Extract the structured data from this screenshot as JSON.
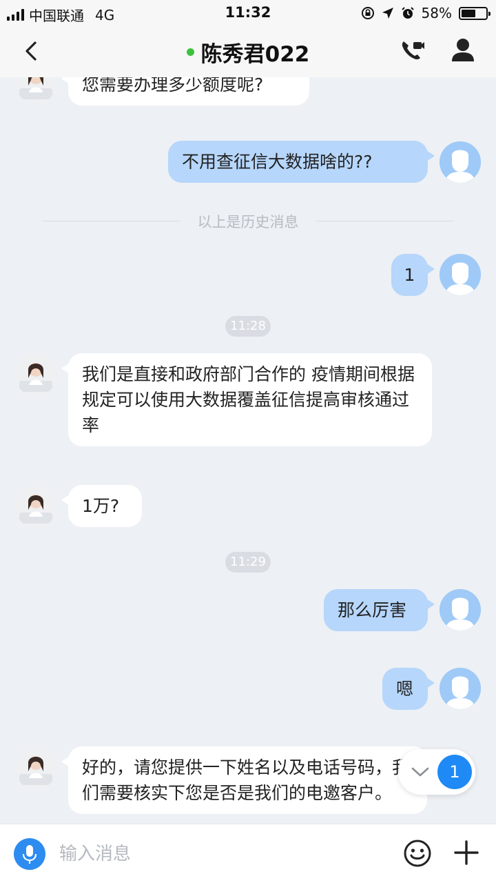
{
  "status_bar": {
    "carrier": "中国联通",
    "network": "4G",
    "time": "11:32",
    "battery_percent": "58%",
    "battery_level": 0.58,
    "icons": [
      "signal-icon",
      "orientation-lock-icon",
      "location-icon",
      "alarm-icon",
      "battery-icon"
    ]
  },
  "header": {
    "title": "陈秀君022",
    "online_color": "#3cc13c",
    "icons": [
      "back-icon",
      "video-call-icon",
      "profile-icon"
    ]
  },
  "messages": [
    {
      "id": "m1",
      "side": "in",
      "text": "您需要办理多少额度呢?"
    },
    {
      "id": "m2",
      "side": "out",
      "text": "不用查征信大数据啥的??"
    },
    {
      "id": "m3",
      "side": "out",
      "text": "1"
    },
    {
      "id": "m4",
      "side": "in",
      "text": "我们是直接和政府部门合作的 疫情期间根据规定可以使用大数据覆盖征信提高审核通过率"
    },
    {
      "id": "m5",
      "side": "in",
      "text": "1万?"
    },
    {
      "id": "m6",
      "side": "out",
      "text": "那么厉害"
    },
    {
      "id": "m7",
      "side": "out",
      "text": "嗯"
    },
    {
      "id": "m8",
      "side": "in",
      "text": "好的，请您提供一下姓名以及电话号码，我们需要核实下您是否是我们的电邀客户。"
    }
  ],
  "history_divider": "以上是历史消息",
  "timestamps": {
    "t1": "11:28",
    "t2": "11:29"
  },
  "new_message_badge": "1",
  "input": {
    "placeholder": "输入消息",
    "value": ""
  },
  "colors": {
    "accent": "#2d8cf0",
    "outgoing_bubble": "#b6d6fb",
    "incoming_bubble": "#ffffff",
    "chat_background": "#edf0f4"
  }
}
